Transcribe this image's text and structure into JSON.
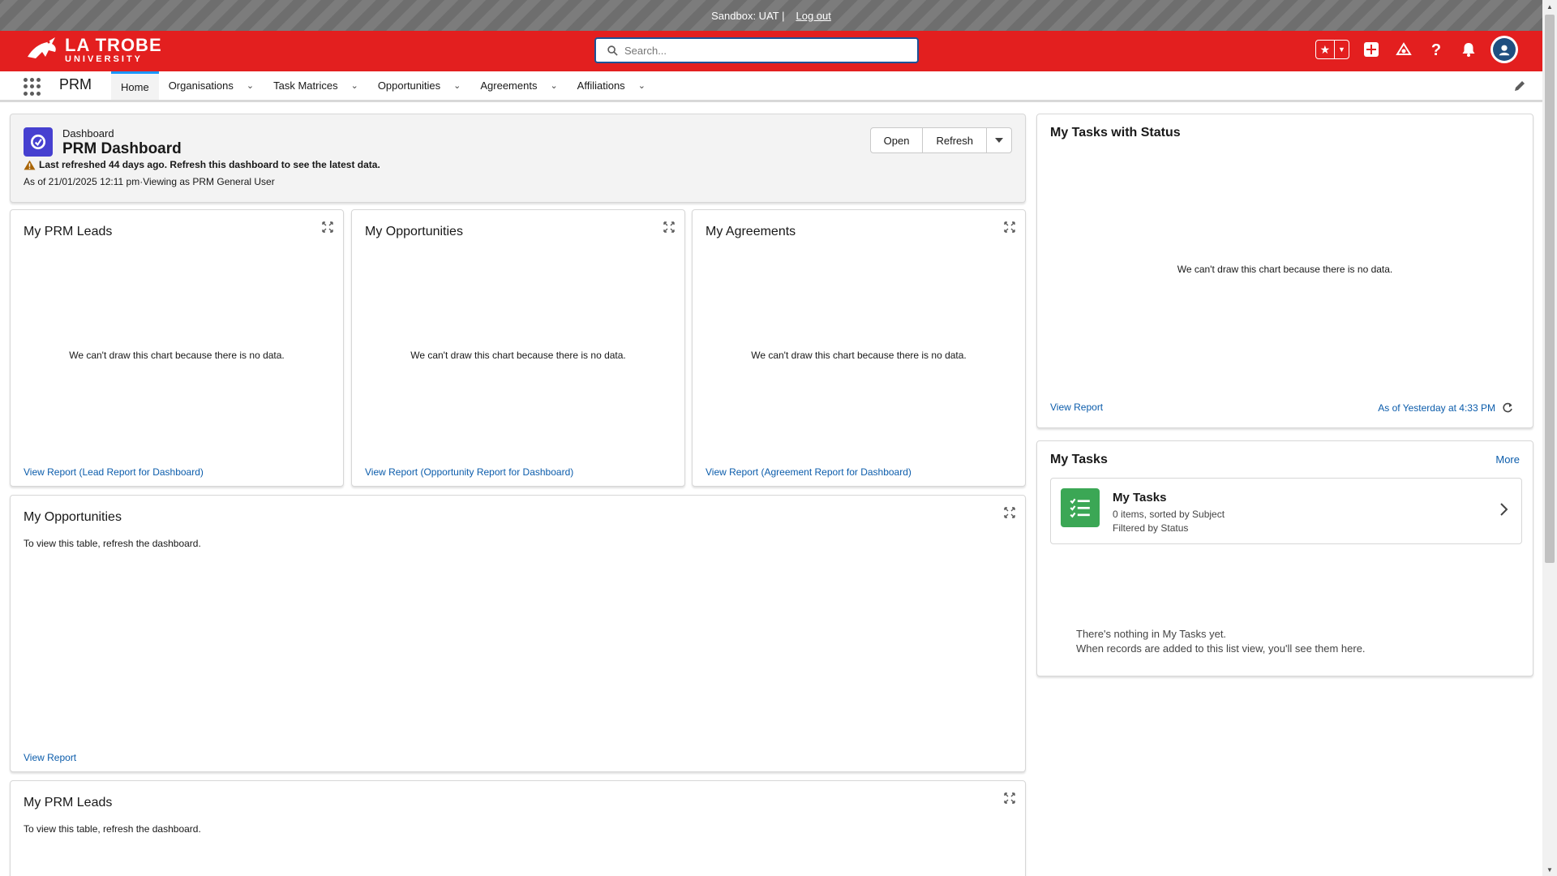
{
  "sandbox": {
    "text": "Sandbox: UAT |",
    "logout": "Log out"
  },
  "header": {
    "logo_line1": "LA TROBE",
    "logo_line2": "UNIVERSITY",
    "search_placeholder": "Search...",
    "brand_color": "#e31f1f"
  },
  "nav": {
    "app_name": "PRM",
    "items": [
      {
        "label": "Home"
      },
      {
        "label": "Organisations"
      },
      {
        "label": "Task Matrices"
      },
      {
        "label": "Opportunities"
      },
      {
        "label": "Agreements"
      },
      {
        "label": "Affiliations"
      }
    ]
  },
  "dashboard": {
    "kicker": "Dashboard",
    "title": "PRM Dashboard",
    "warning": "Last refreshed 44 days ago. Refresh this dashboard to see the latest data.",
    "as_of": "As of 21/01/2025 12:11 pm·Viewing as PRM General User",
    "open_label": "Open",
    "refresh_label": "Refresh"
  },
  "widgets": {
    "leads": {
      "title": "My PRM Leads",
      "nodata": "We can't draw this chart because there is no data.",
      "link": "View Report (Lead Report for Dashboard)"
    },
    "opps": {
      "title": "My Opportunities",
      "nodata": "We can't draw this chart because there is no data.",
      "link": "View Report (Opportunity Report for Dashboard)"
    },
    "agreements": {
      "title": "My Agreements",
      "nodata": "We can't draw this chart because there is no data.",
      "link": "View Report (Agreement Report for Dashboard)"
    },
    "opps_table": {
      "title": "My Opportunities",
      "message": "To view this table, refresh the dashboard.",
      "link": "View Report"
    },
    "leads_table": {
      "title": "My PRM Leads",
      "message": "To view this table, refresh the dashboard."
    }
  },
  "tasks_status": {
    "title": "My Tasks with Status",
    "nodata": "We can't draw this chart because there is no data.",
    "link": "View Report",
    "as_of": "As of Yesterday at 4:33 PM"
  },
  "my_tasks": {
    "title": "My Tasks",
    "more": "More",
    "list_name": "My Tasks",
    "list_sub1": "0 items, sorted by Subject",
    "list_sub2": "Filtered by Status",
    "empty1": "There's nothing in My Tasks yet.",
    "empty2": "When records are added to this list view, you'll see them here."
  },
  "icons": [
    "search-icon",
    "star-icon",
    "add-icon",
    "trailhead-icon",
    "help-icon",
    "bell-icon",
    "avatar",
    "waffle-icon",
    "pencil-icon",
    "expand-icon",
    "warning-icon",
    "refresh-icon",
    "chevron-right-icon",
    "task-list-icon"
  ]
}
